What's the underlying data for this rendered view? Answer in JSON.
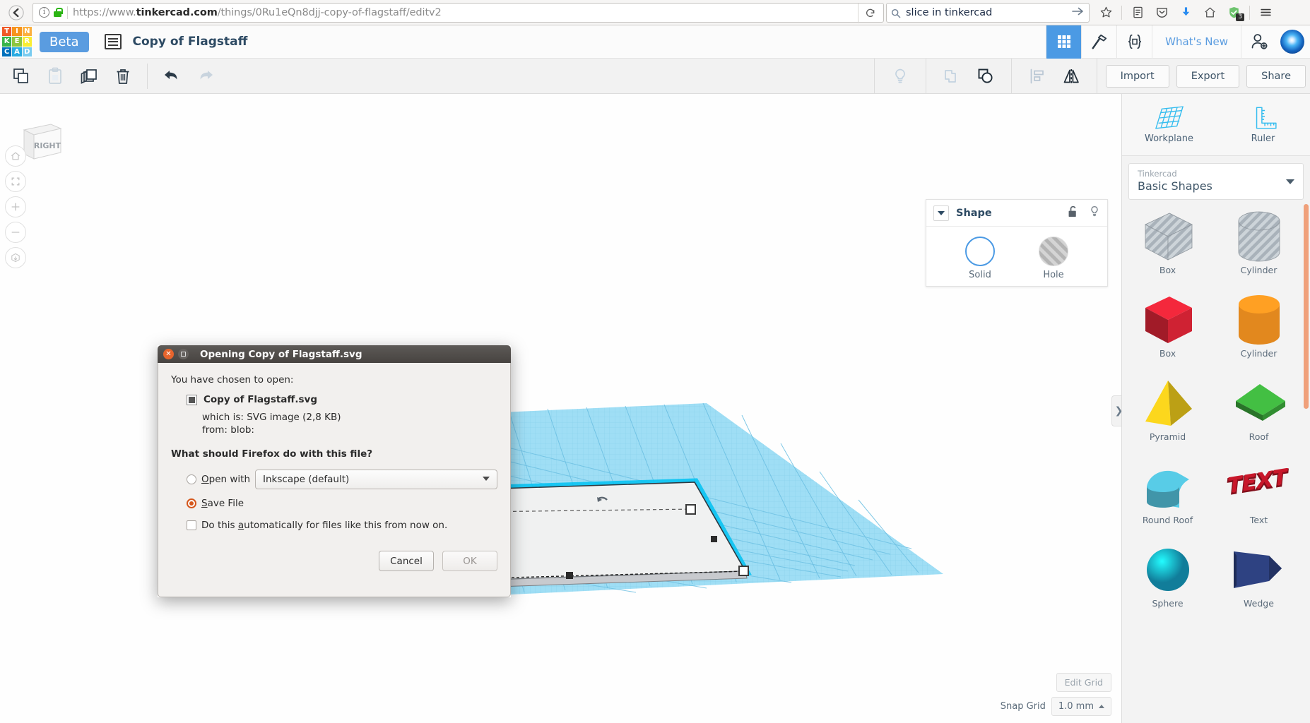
{
  "browser": {
    "back_icon": "back-arrow-icon",
    "info_icon": "page-info-icon",
    "lock_icon": "https-lock-icon",
    "url_prefix": "https://www.",
    "url_domain": "tinkercad.com",
    "url_suffix": "/things/0Ru1eQn8djj-copy-of-flagstaff/editv2",
    "reload_icon": "reload-icon",
    "search_icon": "search-icon",
    "search_value": "slice in tinkercad",
    "go_icon": "go-arrow-icon",
    "icons": [
      "bookmark-star-icon",
      "library-icon",
      "pocket-icon",
      "downloads-icon",
      "home-icon",
      "shield-icon",
      "menu-hamburger-icon"
    ],
    "shield_badge": "3"
  },
  "tinkercad_header": {
    "logo_letters": [
      "T",
      "I",
      "N",
      "K",
      "E",
      "R",
      "C",
      "A",
      "D"
    ],
    "beta_label": "Beta",
    "list_icon": "project-list-icon",
    "project_title": "Copy of Flagstaff",
    "right_icons": [
      "grid-apps-icon",
      "codeblocks-hammer-icon",
      "code-braces-icon"
    ],
    "whats_new": "What's New",
    "invite_icon": "add-person-icon",
    "avatar": "user-avatar"
  },
  "toolbar": {
    "left_tools": [
      "copy-icon",
      "paste-icon",
      "duplicate-icon",
      "delete-trash-icon",
      "undo-icon",
      "redo-icon"
    ],
    "right_tools": [
      "lightbulb-icon",
      "group-icon",
      "ungroup-icon",
      "align-icon",
      "mirror-icon"
    ],
    "import_label": "Import",
    "export_label": "Export",
    "share_label": "Share"
  },
  "canvas": {
    "viewcube_label": "RIGHT",
    "nav_icons": [
      "home-view-icon",
      "fit-view-icon",
      "zoom-in-icon",
      "zoom-out-icon",
      "ortho-view-icon"
    ],
    "edit_grid_label": "Edit Grid",
    "snap_grid_label": "Snap Grid",
    "snap_grid_value": "1.0 mm",
    "collapse_icon": "chevron-right-icon"
  },
  "shape_panel": {
    "title": "Shape",
    "caret_icon": "chevron-down-icon",
    "lock_icon": "unlock-icon",
    "bulb_icon": "lightbulb-icon",
    "solid_label": "Solid",
    "hole_label": "Hole"
  },
  "sidebar": {
    "workplane_label": "Workplane",
    "ruler_label": "Ruler",
    "library_owner": "Tinkercad",
    "library_name": "Basic Shapes",
    "shapes": [
      {
        "name": "Box",
        "kind": "box",
        "color": "#b9c2c8",
        "hatched": true
      },
      {
        "name": "Cylinder",
        "kind": "cylinder",
        "color": "#b9c2c8",
        "hatched": true
      },
      {
        "name": "Box",
        "kind": "box",
        "color": "#cf2233",
        "hatched": false
      },
      {
        "name": "Cylinder",
        "kind": "cylinder",
        "color": "#e2881e",
        "hatched": false
      },
      {
        "name": "Pyramid",
        "kind": "pyramid",
        "color": "#e5c31a",
        "hatched": false
      },
      {
        "name": "Roof",
        "kind": "roof",
        "color": "#3aa63a",
        "hatched": false
      },
      {
        "name": "Round Roof",
        "kind": "roundroof",
        "color": "#4fb6ce",
        "hatched": false
      },
      {
        "name": "Text",
        "kind": "text",
        "color": "#c8172a",
        "hatched": false
      },
      {
        "name": "Sphere",
        "kind": "sphere",
        "color": "#18aed6",
        "hatched": false
      },
      {
        "name": "Wedge",
        "kind": "wedge",
        "color": "#2c3f7c",
        "hatched": false
      }
    ]
  },
  "dialog": {
    "title": "Opening Copy of Flagstaff.svg",
    "close_icon": "window-close-icon",
    "maximize_icon": "window-maximize-icon",
    "intro": "You have chosen to open:",
    "file_icon": "svg-file-icon",
    "file_name": "Copy of Flagstaff.svg",
    "which_is": "which is: SVG image (2,8 KB)",
    "from": "from: blob:",
    "question": "What should Firefox do with this file?",
    "open_with_label": "Open with",
    "open_with_value": "Inkscape (default)",
    "save_file_label": "Save File",
    "auto_label": "Do this automatically for files like this from now on.",
    "cancel_label": "Cancel",
    "ok_label": "OK",
    "selected_option": "save"
  }
}
